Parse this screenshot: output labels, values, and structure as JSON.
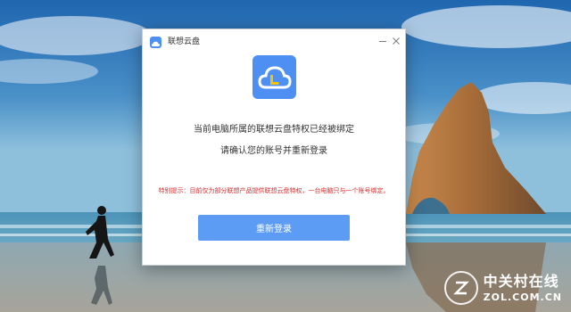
{
  "dialog": {
    "app_title": "联想云盘",
    "icons": {
      "app": "cloud-app-icon",
      "logo": "cloud-logo-icon",
      "minimize": "minimize-icon",
      "close": "close-icon"
    },
    "message_line1": "当前电脑所属的联想云盘特权已经被绑定",
    "message_line2": "请确认您的账号并重新登录",
    "notice": "特别提示：目前仅为部分联想产品提供联想云盘特权，一台电脑只与一个账号绑定。",
    "relogin_button_label": "重新登录",
    "colors": {
      "accent": "#5d9cf5",
      "brand": "#4e8ff3",
      "notice": "#d32f2f"
    }
  },
  "watermark": {
    "text_cn": "中关村在线",
    "text_en": "ZOL.COM.CN"
  }
}
